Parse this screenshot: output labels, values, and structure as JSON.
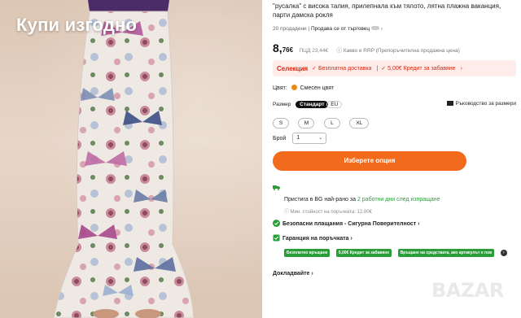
{
  "image": {
    "overlay_text": "Купи изгодно",
    "description_icon": "butterfly-print-mermaid-skirt"
  },
  "product": {
    "title_line_1": "\"русалка\" с висока талия, прилепнала към тялото, лятна плажна ваканция,",
    "title_line_2": "парти дамска рокля",
    "sold_count": "20 продадени",
    "seller_label": "Продава се от търговец",
    "price_main": "8,",
    "price_cents": "76€",
    "old_price": "ПЦД 23,44€",
    "rrp_label": "Какво е RRP (Препоръчителна продажна цена)"
  },
  "promo": {
    "selection_label": "Селекция",
    "free_shipping": "Безплатна доставка",
    "credit": "5,00€ Кредит за забавяне"
  },
  "options": {
    "color_label": "Цвят:",
    "color_value": "Смесен цвят",
    "color_swatch": "#e8891a",
    "size_label": "Размер",
    "size_standard": "Стандарт",
    "size_eu": "EU",
    "size_guide": "Ръководство за размери",
    "sizes": [
      "S",
      "M",
      "L",
      "XL"
    ],
    "qty_label": "Брой",
    "qty_value": "1"
  },
  "cta": {
    "label": "Изберете опция"
  },
  "shipping": {
    "line1_prefix": "Пристига в BG най-рано за",
    "line1_highlight": "2 работни дни след изпращане",
    "line2": "Мин. стойност на поръчката: 12,00€"
  },
  "safety": {
    "payments": "Безопасни плащания - Сигурна Поверителност",
    "guarantee": "Гаранция на поръчката",
    "badges": [
      "Безплатно връщане",
      "5,00€ Кредит за забавяне",
      "Връщане на средствата, ако артикулът е пов"
    ]
  },
  "report": "Докладвайте",
  "watermark": "BAZAR",
  "colors": {
    "accent_orange": "#f26b1d",
    "promo_red": "#d12b16",
    "success_green": "#2a9d39"
  }
}
